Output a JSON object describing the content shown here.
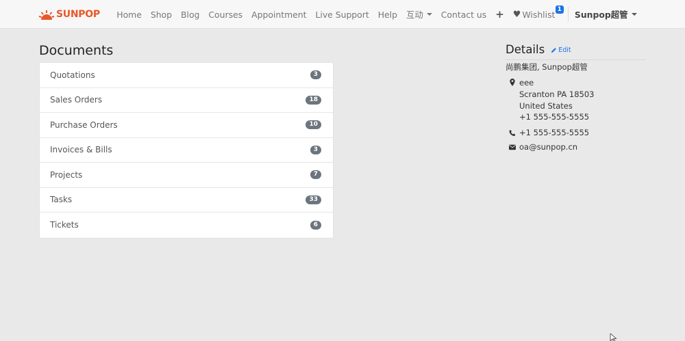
{
  "brand": {
    "name": "SUNPOP",
    "accent": "#e8582a"
  },
  "nav": {
    "items": [
      "Home",
      "Shop",
      "Blog",
      "Courses",
      "Appointment",
      "Live Support",
      "Help"
    ],
    "dropdown_label": "互动",
    "contact_label": "Contact us",
    "plus_icon": "+",
    "wishlist_label": "Wishlist",
    "wishlist_count": "1",
    "user_label": "Sunpop超管"
  },
  "documents": {
    "title": "Documents",
    "items": [
      {
        "label": "Quotations",
        "count": "3"
      },
      {
        "label": "Sales Orders",
        "count": "18"
      },
      {
        "label": "Purchase Orders",
        "count": "10"
      },
      {
        "label": "Invoices & Bills",
        "count": "3"
      },
      {
        "label": "Projects",
        "count": "7"
      },
      {
        "label": "Tasks",
        "count": "33"
      },
      {
        "label": "Tickets",
        "count": "6"
      }
    ]
  },
  "details": {
    "title": "Details",
    "edit_label": "Edit",
    "company": "尚鹏集团, Sunpop超管",
    "address": [
      "eee",
      "Scranton PA 18503",
      "United States",
      "+1 555-555-5555"
    ],
    "phone": "+1 555-555-5555",
    "email": "oa@sunpop.cn"
  },
  "colors": {
    "link": "#1a73e8",
    "badge": "#6c757d",
    "background": "#e9e9e9"
  }
}
